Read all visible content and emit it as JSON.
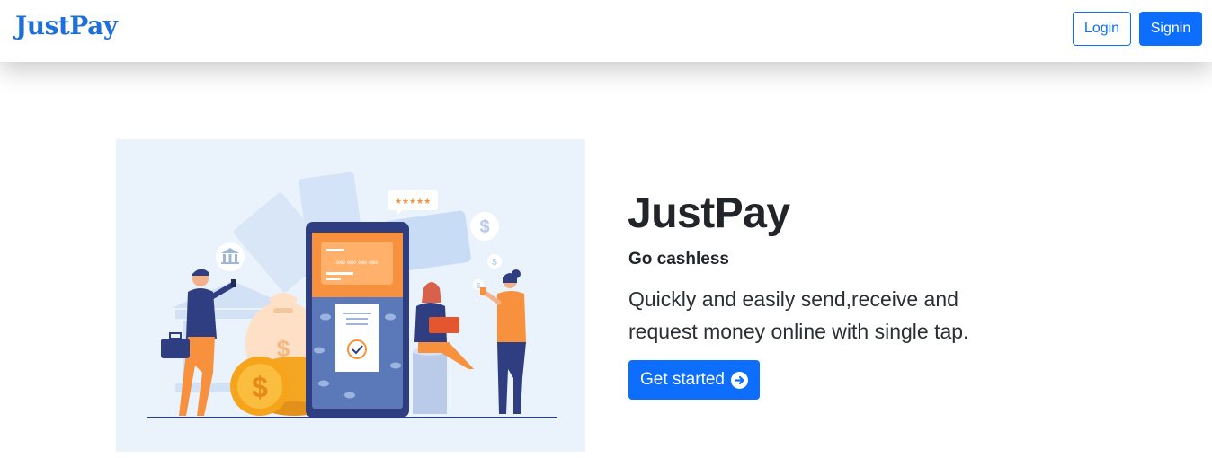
{
  "navbar": {
    "brand": "JustPay",
    "login_label": "Login",
    "signin_label": "Signin"
  },
  "hero": {
    "title": "JustPay",
    "tagline": "Go cashless",
    "description": "Quickly and easily send,receive and request money online with single tap.",
    "cta_label": "Get started",
    "cta_icon": "arrow-right-circle-icon",
    "illustration": {
      "card_number": "0000 0000 0000 0000",
      "rating_stars": "★★★★★"
    }
  },
  "colors": {
    "primary": "#0d6efd",
    "brand": "#1e6fd9",
    "illustration_bg": "#eaf2fb",
    "accent_orange": "#f7913d",
    "phone_navy": "#2f3e80"
  }
}
